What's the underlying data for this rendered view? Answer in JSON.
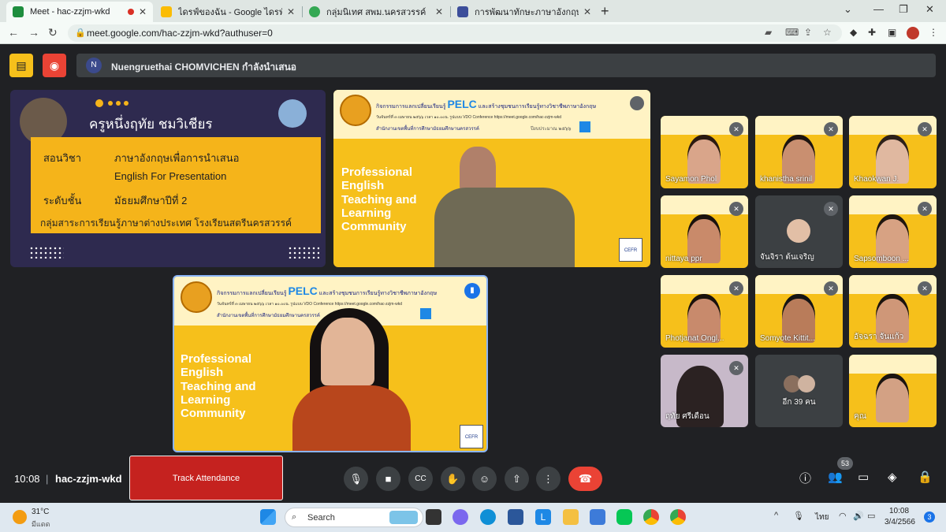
{
  "browser": {
    "tabs": [
      {
        "title": "Meet - hac-zzjm-wkd",
        "fav": "#1e8e3e"
      },
      {
        "title": "ไดรฟ์ของฉัน - Google ไดรฟ์",
        "fav": "#fbbc04"
      },
      {
        "title": "กลุ่มนิเทศ สพม.นครสวรรค์",
        "fav": "#34a853"
      },
      {
        "title": "การพัฒนาทักษะภาษาอังกฤษ English",
        "fav": "#3c4e9a"
      }
    ],
    "url": "meet.google.com/hac-zzjm-wkd?authuser=0"
  },
  "meet": {
    "presenter_initial": "N",
    "presenter_banner": "Nuengruethai CHOMVICHEN กำลังนำเสนอ",
    "time": "10:08",
    "meeting_code": "hac-zzjm-wkd",
    "track_attendance": "Track Attendance",
    "participant_count": "53"
  },
  "slide": {
    "teacher": "ครูหนึ่งฤทัย   ชมวิเชียร",
    "subject_label": "สอนวิชา",
    "subject_th": "ภาษาอังกฤษเพื่อการนำเสนอ",
    "subject_en": "English For Presentation",
    "level_label": "ระดับชั้น",
    "level": "มัธยมศึกษาปีที่ 2",
    "dept": "กลุ่มสาระการเรียนรู้ภาษาต่างประเทศ โรงเรียนสตรีนครสวรรค์"
  },
  "banner": {
    "head": "กิจกรรมการแลกเปลี่ยนเรียนรู้",
    "pelc": "PELC",
    "head2": "และสร้างชุมชนการเรียนรู้ทางวิชาชีพภาษาอังกฤษ",
    "sub": "วันจันทร์ที่ ๓ เมษายน ๒๕๖๖ เวลา ๑๐.๐๐น. รูปแบบ VDO Conference https://meet.google.com/hac-zzjm-wkd",
    "office": "สำนักงานเขตพื้นที่การศึกษามัธยมศึกษานครสวรรค์",
    "year": "ปีงบประมาณ ๒๕๖๖",
    "cefr": "CEFR",
    "professional": "Professional English Teaching and Learning Community"
  },
  "participants": [
    {
      "name": "Sayamon Phol",
      "skin": "#d9a58a",
      "hair": "#2a1a12"
    },
    {
      "name": "khanistha srinil",
      "skin": "#c98f70",
      "hair": "#1d1410"
    },
    {
      "name": "Khaokwan J.",
      "skin": "#e0b8a0",
      "hair": "#2d211a"
    },
    {
      "name": "nittaya ppr",
      "skin": "#c98a6a",
      "hair": "#1a120e"
    },
    {
      "name": "จันจิรา ต้นเจริญ",
      "skin": "#e2bfa6",
      "hair": "#1e1712"
    },
    {
      "name": "Sapsomboon ...",
      "skin": "#d7a283",
      "hair": "#1f160f"
    },
    {
      "name": "Photjanat Ongl...",
      "skin": "#c88a6c",
      "hair": "#1a120d"
    },
    {
      "name": "Somyote Kittit...",
      "skin": "#b97c5a",
      "hair": "#141414"
    },
    {
      "name": "อัจฉรา จันแก้ว",
      "skin": "#cf9778",
      "hair": "#1a130e"
    },
    {
      "name": "ฤทัย ศรีเดือน",
      "skin": "#b68c80",
      "hair": "#211712"
    },
    {
      "name": "อีก 39 คน",
      "skin": "#cfb3a0",
      "hair": "#3a2a20"
    },
    {
      "name": "คุณ",
      "skin": "#d3a184",
      "hair": "#1b1410"
    }
  ],
  "taskbar": {
    "temp": "31°C",
    "weather": "มีแดด",
    "search": "Search",
    "lang": "ไทย",
    "clock": "10:08",
    "date": "3/4/2566",
    "notif": "3"
  }
}
